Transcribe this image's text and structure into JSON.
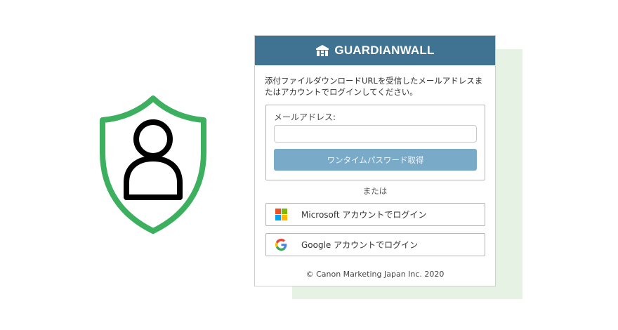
{
  "illustration": {
    "icon": "shield-user-icon",
    "shield_color": "#3cb05f",
    "user_color": "#000000"
  },
  "background_panel_color": "#e6f3e4",
  "header": {
    "logo_icon": "guardianwall-logo-icon",
    "logo_text": "GUARDIANWALL",
    "color": "#3f7391"
  },
  "instruction": "添付ファイルダウンロードURLを受信したメールアドレスまたはアカウントでログインしてください。",
  "email_form": {
    "label": "メールアドレス:",
    "value": "",
    "placeholder": "",
    "submit_label": "ワンタイムパスワード取得",
    "submit_color": "#79aac8"
  },
  "divider_text": "または",
  "sso": {
    "microsoft": {
      "icon": "microsoft-icon",
      "label": "Microsoft アカウントでログイン"
    },
    "google": {
      "icon": "google-icon",
      "label": "Google アカウントでログイン"
    }
  },
  "footer": {
    "copyright": "© Canon Marketing Japan Inc. 2020"
  }
}
